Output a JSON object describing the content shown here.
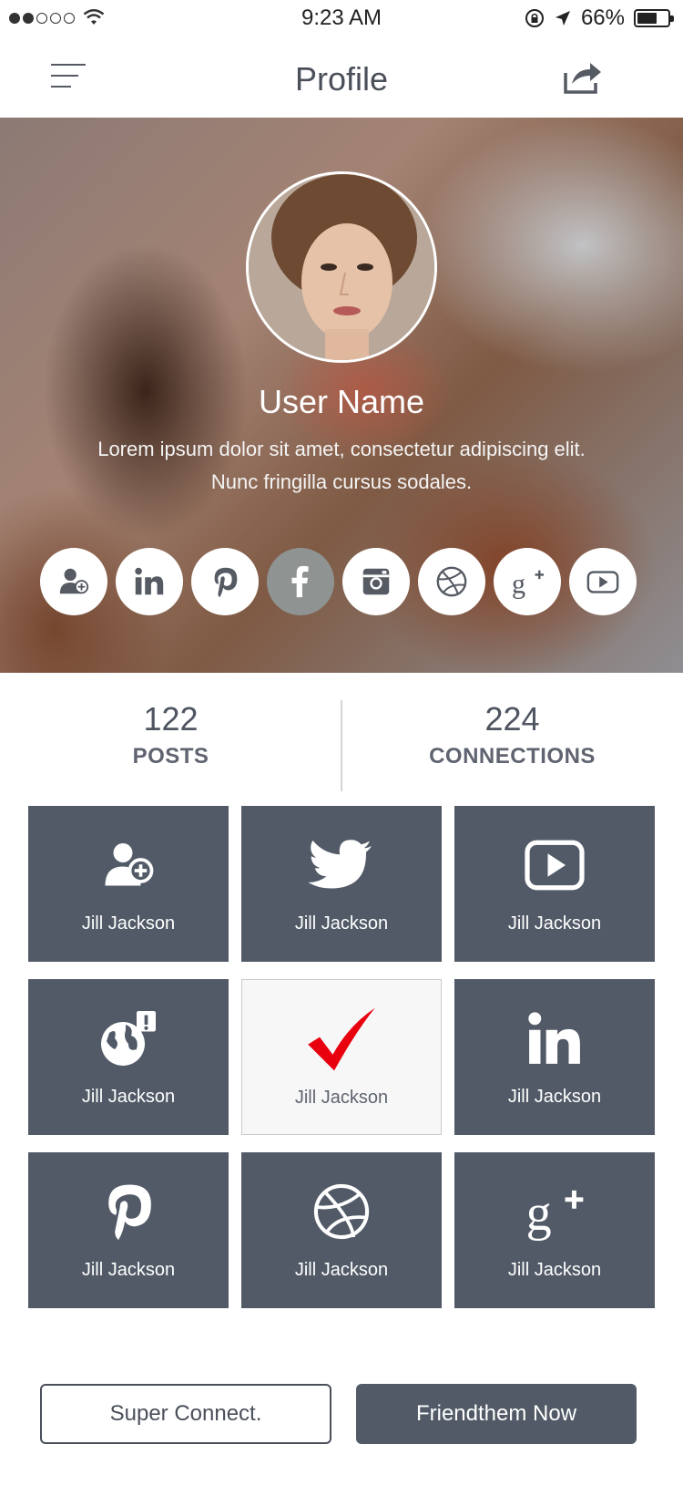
{
  "status_bar": {
    "time": "9:23 AM",
    "battery_percent": "66%",
    "battery_level": 0.66,
    "signal_bars_filled": 2,
    "signal_bars_total": 5
  },
  "nav": {
    "title": "Profile",
    "menu_icon": "hamburger-icon",
    "share_icon": "share-icon"
  },
  "profile": {
    "name": "User Name",
    "bio_line1": "Lorem ipsum dolor sit amet, consectetur adipiscing elit.",
    "bio_line2": "Nunc fringilla cursus sodales."
  },
  "social_buttons": [
    {
      "icon": "add-user-icon"
    },
    {
      "icon": "linkedin-icon"
    },
    {
      "icon": "pinterest-icon"
    },
    {
      "icon": "facebook-icon",
      "active": true
    },
    {
      "icon": "instagram-icon"
    },
    {
      "icon": "dribbble-icon"
    },
    {
      "icon": "google-plus-icon"
    },
    {
      "icon": "youtube-icon"
    }
  ],
  "stats": {
    "posts_count": "122",
    "posts_label": "POSTS",
    "connections_count": "224",
    "connections_label": "CONNECTIONS"
  },
  "tiles": [
    {
      "name": "Jill Jackson",
      "icon": "add-user-icon"
    },
    {
      "name": "Jill Jackson",
      "icon": "twitter-icon"
    },
    {
      "name": "Jill Jackson",
      "icon": "youtube-icon"
    },
    {
      "name": "Jill Jackson",
      "icon": "globe-alert-icon"
    },
    {
      "name": "Jill Jackson",
      "icon": "checkmark-icon",
      "selected": true
    },
    {
      "name": "Jill Jackson",
      "icon": "linkedin-icon"
    },
    {
      "name": "Jill Jackson",
      "icon": "pinterest-icon"
    },
    {
      "name": "Jill Jackson",
      "icon": "dribbble-icon"
    },
    {
      "name": "Jill Jackson",
      "icon": "google-plus-icon"
    }
  ],
  "buttons": {
    "secondary": "Super Connect.",
    "primary": "Friendthem Now"
  },
  "colors": {
    "tile_bg": "#515a66",
    "accent_red": "#e8000e",
    "text_dark": "#4a4f5a"
  }
}
